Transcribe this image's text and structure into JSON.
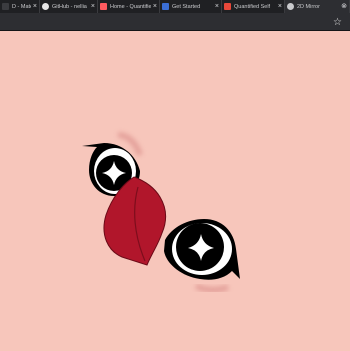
{
  "tabs": [
    {
      "label": "D - Materialize",
      "icon": "materialize-icon",
      "color": "#3b3c40"
    },
    {
      "label": "GitHub - nellia",
      "icon": "github-icon",
      "color": "#e6e6e6"
    },
    {
      "label": "Home - Quantified",
      "icon": "quantified-icon",
      "color": "#ff5a5f"
    },
    {
      "label": "Get Started",
      "icon": "docs-icon",
      "color": "#3b6fd6"
    },
    {
      "label": "Quantified Self",
      "icon": "quantified-self-icon",
      "color": "#e8483a"
    },
    {
      "label": "2D Mirror",
      "icon": "globe-icon",
      "color": "#c9cacd"
    }
  ],
  "toolbar": {
    "star_icon": "star-icon"
  },
  "colors": {
    "background": "#f7c6bb",
    "lips": "#b1162b",
    "eye_white": "#ffffff",
    "outline": "#000000"
  }
}
